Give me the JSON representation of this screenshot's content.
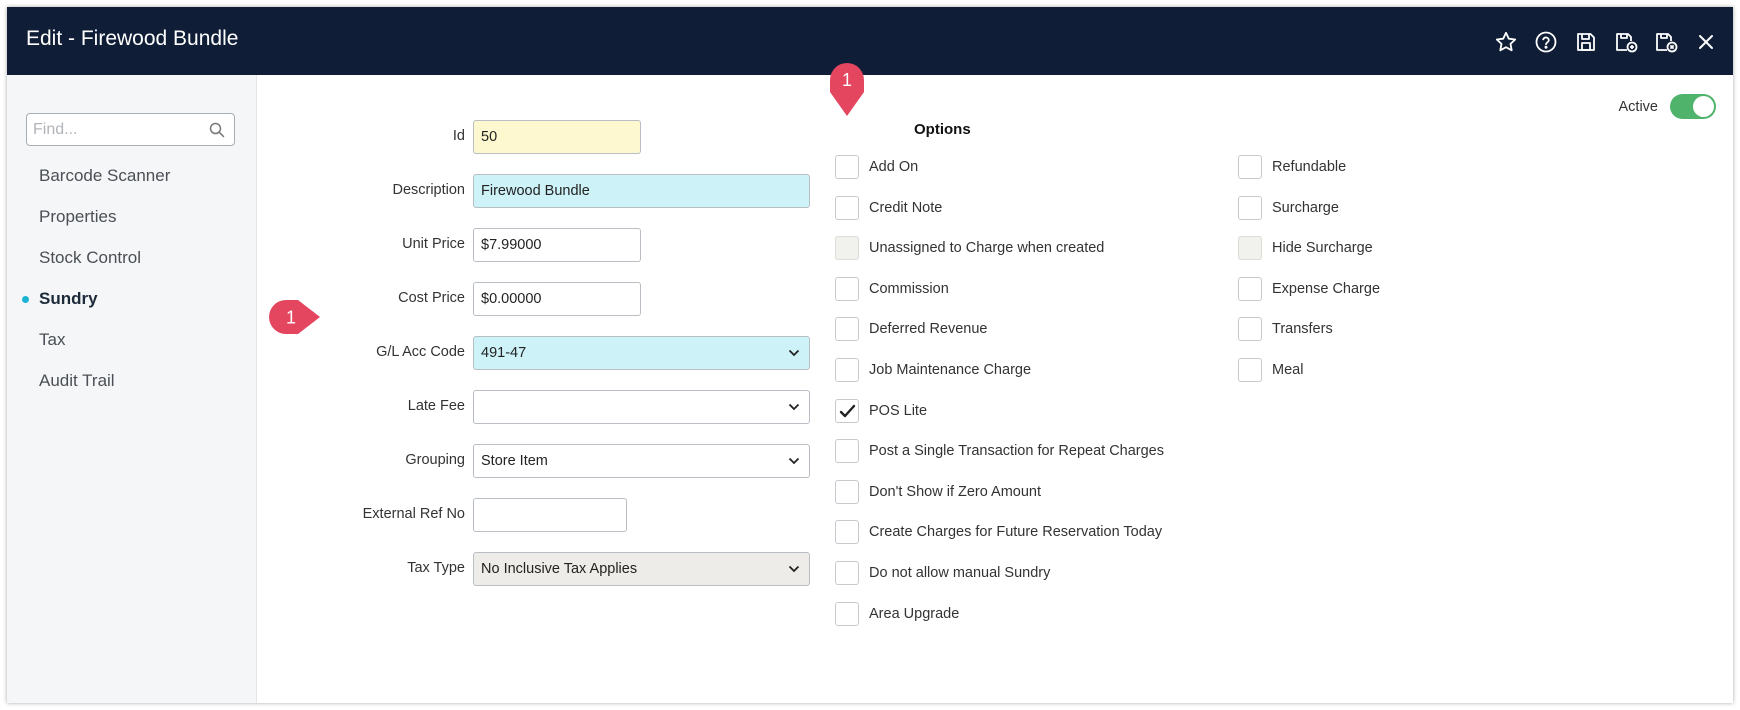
{
  "window": {
    "title": "Edit - Firewood Bundle"
  },
  "toolbar": {
    "icons": [
      "star-icon",
      "help-icon",
      "save-icon",
      "save-add-icon",
      "save-close-icon",
      "close-icon"
    ]
  },
  "sidebar": {
    "find_placeholder": "Find...",
    "items": [
      {
        "label": "Barcode Scanner",
        "active": false
      },
      {
        "label": "Properties",
        "active": false
      },
      {
        "label": "Stock Control",
        "active": false
      },
      {
        "label": "Sundry",
        "active": true
      },
      {
        "label": "Tax",
        "active": false
      },
      {
        "label": "Audit Trail",
        "active": false
      }
    ]
  },
  "form": {
    "id": {
      "label": "Id",
      "value": "50"
    },
    "description": {
      "label": "Description",
      "value": "Firewood Bundle"
    },
    "unit_price": {
      "label": "Unit Price",
      "value": "$7.99000"
    },
    "cost_price": {
      "label": "Cost Price",
      "value": "$0.00000"
    },
    "gl_acc_code": {
      "label": "G/L Acc Code",
      "value": "491-47"
    },
    "late_fee": {
      "label": "Late Fee",
      "value": ""
    },
    "grouping": {
      "label": "Grouping",
      "value": "Store Item"
    },
    "external_ref_no": {
      "label": "External Ref No",
      "value": ""
    },
    "tax_type": {
      "label": "Tax Type",
      "value": "No Inclusive Tax Applies"
    }
  },
  "options": {
    "title": "Options",
    "left": [
      {
        "label": "Add On",
        "checked": false,
        "disabled": false
      },
      {
        "label": "Credit Note",
        "checked": false,
        "disabled": false
      },
      {
        "label": "Unassigned to Charge when created",
        "checked": false,
        "disabled": true
      },
      {
        "label": "Commission",
        "checked": false,
        "disabled": false
      },
      {
        "label": "Deferred Revenue",
        "checked": false,
        "disabled": false
      },
      {
        "label": "Job Maintenance Charge",
        "checked": false,
        "disabled": false
      },
      {
        "label": "POS Lite",
        "checked": true,
        "disabled": false
      },
      {
        "label": "Post a Single Transaction for Repeat Charges",
        "checked": false,
        "disabled": false
      },
      {
        "label": "Don't Show if Zero Amount",
        "checked": false,
        "disabled": false
      },
      {
        "label": "Create Charges for Future Reservation Today",
        "checked": false,
        "disabled": false
      },
      {
        "label": "Do not allow manual Sundry",
        "checked": false,
        "disabled": false
      },
      {
        "label": "Area Upgrade",
        "checked": false,
        "disabled": false
      }
    ],
    "right": [
      {
        "label": "Refundable",
        "checked": false,
        "disabled": false
      },
      {
        "label": "Surcharge",
        "checked": false,
        "disabled": false
      },
      {
        "label": "Hide Surcharge",
        "checked": false,
        "disabled": true
      },
      {
        "label": "Expense Charge",
        "checked": false,
        "disabled": false
      },
      {
        "label": "Transfers",
        "checked": false,
        "disabled": false
      },
      {
        "label": "Meal",
        "checked": false,
        "disabled": false
      }
    ]
  },
  "active_toggle": {
    "label": "Active",
    "on": true
  },
  "markers": [
    {
      "label": "1",
      "color": "#e4455f"
    },
    {
      "label": "1",
      "color": "#e4455f"
    }
  ]
}
